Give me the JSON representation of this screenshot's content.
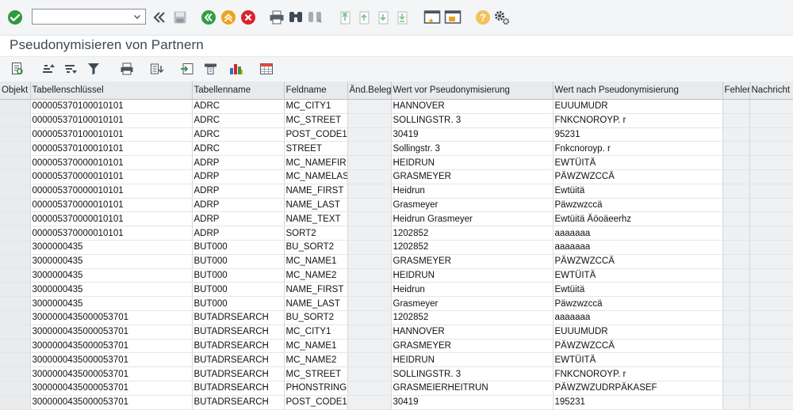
{
  "title": "Pseudonymisieren von Partnern",
  "command_field": {
    "value": ""
  },
  "system_toolbar_icons": [
    "enter-icon",
    "back-icon",
    "save-icon",
    "back-green-icon",
    "exit-icon",
    "cancel-icon",
    "print-icon",
    "find-icon",
    "find-next-icon",
    "first-page-icon",
    "previous-page-icon",
    "next-page-icon",
    "last-page-icon",
    "create-session-icon",
    "shortcut-icon",
    "help-icon",
    "settings-icon"
  ],
  "alv_toolbar_icons": [
    "details-icon",
    "sort-ascending-icon",
    "sort-descending-icon",
    "filter-icon",
    "print-icon",
    "export-icon",
    "local-file-icon",
    "layout-icon",
    "graphic-icon",
    "table-view-icon"
  ],
  "table": {
    "columns": [
      "Objekt",
      "Tabellenschlüssel",
      "Tabellenname",
      "Feldname",
      "Änd.Beleg",
      "Wert vor Pseudonymisierung",
      "Wert nach Pseudonymisierung",
      "Fehler",
      "Nachricht"
    ],
    "rows": [
      [
        "",
        "000005370100010101",
        "ADRC",
        "MC_CITY1",
        "",
        "HANNOVER",
        "EUUUMUDR",
        "",
        ""
      ],
      [
        "",
        "000005370100010101",
        "ADRC",
        "MC_STREET",
        "",
        "SOLLINGSTR. 3",
        "FNKCNOROYP. r",
        "",
        ""
      ],
      [
        "",
        "000005370100010101",
        "ADRC",
        "POST_CODE1",
        "",
        "30419",
        "95231",
        "",
        ""
      ],
      [
        "",
        "000005370100010101",
        "ADRC",
        "STREET",
        "",
        "Sollingstr. 3",
        "Fnkcnoroyp. r",
        "",
        ""
      ],
      [
        "",
        "000005370000010101",
        "ADRP",
        "MC_NAMEFIR",
        "",
        "HEIDRUN",
        "EWTÜITÄ",
        "",
        ""
      ],
      [
        "",
        "000005370000010101",
        "ADRP",
        "MC_NAMELAS",
        "",
        "GRASMEYER",
        "PÄWZWZCCÄ",
        "",
        ""
      ],
      [
        "",
        "000005370000010101",
        "ADRP",
        "NAME_FIRST",
        "",
        "Heidrun",
        "Ewtüitä",
        "",
        ""
      ],
      [
        "",
        "000005370000010101",
        "ADRP",
        "NAME_LAST",
        "",
        "Grasmeyer",
        "Päwzwzccä",
        "",
        ""
      ],
      [
        "",
        "000005370000010101",
        "ADRP",
        "NAME_TEXT",
        "",
        "Heidrun Grasmeyer",
        "Ewtüitä Äöoäeerhz",
        "",
        ""
      ],
      [
        "",
        "000005370000010101",
        "ADRP",
        "SORT2",
        "",
        "1202852",
        "aaaaaaa",
        "",
        ""
      ],
      [
        "",
        "3000000435",
        "BUT000",
        "BU_SORT2",
        "",
        "1202852",
        "aaaaaaa",
        "",
        ""
      ],
      [
        "",
        "3000000435",
        "BUT000",
        "MC_NAME1",
        "",
        "GRASMEYER",
        "PÄWZWZCCÄ",
        "",
        ""
      ],
      [
        "",
        "3000000435",
        "BUT000",
        "MC_NAME2",
        "",
        "HEIDRUN",
        "EWTÜITÄ",
        "",
        ""
      ],
      [
        "",
        "3000000435",
        "BUT000",
        "NAME_FIRST",
        "",
        "Heidrun",
        "Ewtüitä",
        "",
        ""
      ],
      [
        "",
        "3000000435",
        "BUT000",
        "NAME_LAST",
        "",
        "Grasmeyer",
        "Päwzwzccä",
        "",
        ""
      ],
      [
        "",
        "3000000435000053701",
        "BUTADRSEARCH",
        "BU_SORT2",
        "",
        "1202852",
        "aaaaaaa",
        "",
        ""
      ],
      [
        "",
        "3000000435000053701",
        "BUTADRSEARCH",
        "MC_CITY1",
        "",
        "HANNOVER",
        "EUUUMUDR",
        "",
        ""
      ],
      [
        "",
        "3000000435000053701",
        "BUTADRSEARCH",
        "MC_NAME1",
        "",
        "GRASMEYER",
        "PÄWZWZCCÄ",
        "",
        ""
      ],
      [
        "",
        "3000000435000053701",
        "BUTADRSEARCH",
        "MC_NAME2",
        "",
        "HEIDRUN",
        "EWTÜITÄ",
        "",
        ""
      ],
      [
        "",
        "3000000435000053701",
        "BUTADRSEARCH",
        "MC_STREET",
        "",
        "SOLLINGSTR. 3",
        "FNKCNOROYP. r",
        "",
        ""
      ],
      [
        "",
        "3000000435000053701",
        "BUTADRSEARCH",
        "PHONSTRING",
        "",
        "GRASMEIERHEITRUN",
        "PÄWZWZUDRPÄKASEF",
        "",
        ""
      ],
      [
        "",
        "3000000435000053701",
        "BUTADRSEARCH",
        "POST_CODE1",
        "",
        "30419",
        "195231",
        "",
        ""
      ]
    ]
  },
  "colors": {
    "toolbar_bg": "#f4f5f6",
    "header_bg": "#e8eaec",
    "enter_green": "#2e9a3e",
    "nav_green": "#2f9e47",
    "exit_orange": "#f0a21b",
    "cancel_red": "#d9232e",
    "title_text": "#3d4750"
  }
}
